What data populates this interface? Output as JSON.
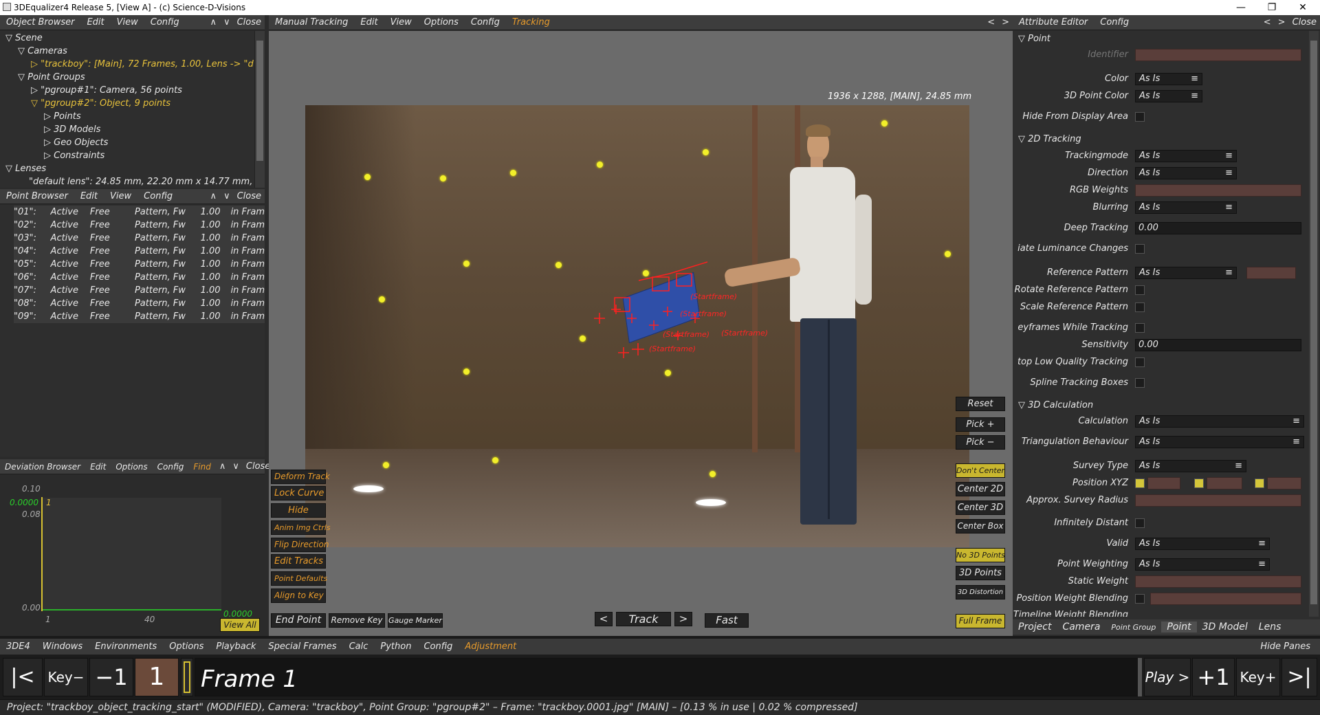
{
  "window": {
    "title": "3DEqualizer4 Release 5, [View A]  -  (c) Science-D-Visions"
  },
  "object_browser": {
    "menu": [
      "Object Browser",
      "Edit",
      "View",
      "Config"
    ],
    "close": "Close",
    "tree": [
      "▽  Scene",
      "▽  Cameras",
      "▷  \"trackboy\":  [Main], 72 Frames, 1.00, Lens -> \"d",
      "▽  Point Groups",
      "▷  \"pgroup#1\":  Camera, 56 points",
      "▽  \"pgroup#2\":  Object, 9 points",
      "▷  Points",
      "▷  3D Models",
      "▷  Geo Objects",
      "▷  Constraints",
      "▽  Lenses",
      "\"default lens\":  24.85 mm, 22.20 mm x 14.77 mm,"
    ]
  },
  "point_browser": {
    "menu": [
      "Point Browser",
      "Edit",
      "View",
      "Config"
    ],
    "close": "Close",
    "rows": [
      [
        "\"01\":",
        "Active",
        "Free",
        "Pattern, Fw",
        "1.00",
        "in Fram"
      ],
      [
        "\"02\":",
        "Active",
        "Free",
        "Pattern, Fw",
        "1.00",
        "in Fram"
      ],
      [
        "\"03\":",
        "Active",
        "Free",
        "Pattern, Fw",
        "1.00",
        "in Fram"
      ],
      [
        "\"04\":",
        "Active",
        "Free",
        "Pattern, Fw",
        "1.00",
        "in Fram"
      ],
      [
        "\"05\":",
        "Active",
        "Free",
        "Pattern, Fw",
        "1.00",
        "in Fram"
      ],
      [
        "\"06\":",
        "Active",
        "Free",
        "Pattern, Fw",
        "1.00",
        "in Fram"
      ],
      [
        "\"07\":",
        "Active",
        "Free",
        "Pattern, Fw",
        "1.00",
        "in Fram"
      ],
      [
        "\"08\":",
        "Active",
        "Free",
        "Pattern, Fw",
        "1.00",
        "in Fram"
      ],
      [
        "\"09\":",
        "Active",
        "Free",
        "Pattern, Fw",
        "1.00",
        "in Fram"
      ]
    ]
  },
  "deviation_browser": {
    "menu": [
      "Deviation Browser",
      "Edit",
      "Options",
      "Config",
      "Find"
    ],
    "close": "Close",
    "y_top": "0.10",
    "y_mid": "0.08",
    "y_bottom": "0.00",
    "cur_value": "0.0000",
    "marker": "1",
    "end_value": "0.0000",
    "x1": "1",
    "x2": "40",
    "view_all": "View All"
  },
  "viewport": {
    "menu": [
      "Manual Tracking",
      "Edit",
      "View",
      "Options",
      "Config",
      "Tracking"
    ],
    "info": "1936 x 1288, [MAIN], 24.85 mm",
    "left_buttons": [
      "Deform Track",
      "Lock Curve",
      "Hide",
      "Anim Img Ctrls",
      "Flip Direction",
      "Edit Tracks",
      "Point Defaults",
      "Align to Key"
    ],
    "right_buttons": {
      "reset": "Reset",
      "pick_plus": "Pick +",
      "pick_minus": "Pick −",
      "dont_center": "Don't Center",
      "center2d": "Center 2D",
      "center3d": "Center 3D",
      "center_box": "Center Box",
      "no3d": "No 3D Points",
      "pts3d": "3D Points",
      "distortion": "3D Distortion",
      "full_frame": "Full Frame"
    },
    "bottom": {
      "end_point": "End Point",
      "remove_key": "Remove Key",
      "gauge_marker": "Gauge Marker",
      "prev": "<",
      "track": "Track",
      "next": ">",
      "fast": "Fast"
    },
    "track_labels": [
      "(Startframe)",
      "(Startframe)",
      "(Startframe)",
      "(Startframe)",
      "(Startframe)"
    ]
  },
  "attribute_editor": {
    "menu": [
      "Attribute Editor",
      "Config"
    ],
    "close": "Close",
    "sections": {
      "point": "Point",
      "tracking": "2D Tracking",
      "calc": "3D Calculation"
    },
    "labels": {
      "identifier": "Identifier",
      "color": "Color",
      "pcolor": "3D Point Color",
      "hide": "Hide From Display Area",
      "trackingmode": "Trackingmode",
      "direction": "Direction",
      "rgb": "RGB Weights",
      "blurring": "Blurring",
      "deep": "Deep Tracking",
      "lum": "iate Luminance Changes",
      "ref": "Reference Pattern",
      "rot": "Rotate Reference Pattern",
      "scale": "Scale Reference Pattern",
      "key": "eyframes While Tracking",
      "sens": "Sensitivity",
      "stop": "top Low Quality Tracking",
      "spline": "Spline Tracking Boxes",
      "calculation": "Calculation",
      "tri": "Triangulation Behaviour",
      "survey": "Survey Type",
      "pos": "Position XYZ",
      "radius": "Approx. Survey Radius",
      "inf": "Infinitely Distant",
      "valid": "Valid",
      "pw": "Point Weighting",
      "sw": "Static Weight",
      "pwb": "Position Weight Blending",
      "twb": "Timeline Weight Blending"
    },
    "as_is": "As Is",
    "deep_value": "0.00",
    "sens_value": "0.00",
    "tabs": [
      "Project",
      "Camera",
      "Point Group",
      "Point",
      "3D Model",
      "Lens"
    ]
  },
  "bottom_menu": {
    "items": [
      "3DE4",
      "Windows",
      "Environments",
      "Options",
      "Playback",
      "Special Frames",
      "Calc",
      "Python",
      "Config",
      "Adjustment"
    ],
    "hide_panes": "Hide Panes"
  },
  "timeline": {
    "first": "|<",
    "key_minus": "Key−",
    "minus1": "−1",
    "frame_num": "1",
    "frame_label": "Frame 1",
    "play": "Play >",
    "plus1": "+1",
    "key_plus": "Key+",
    "last": ">|"
  },
  "status": "Project: \"trackboy_object_tracking_start\"  (MODIFIED), Camera: \"trackboy\", Point Group: \"pgroup#2\"  –  Frame: \"trackboy.0001.jpg\"  [MAIN]  –  [0.13 % in use | 0.02 % compressed]"
}
